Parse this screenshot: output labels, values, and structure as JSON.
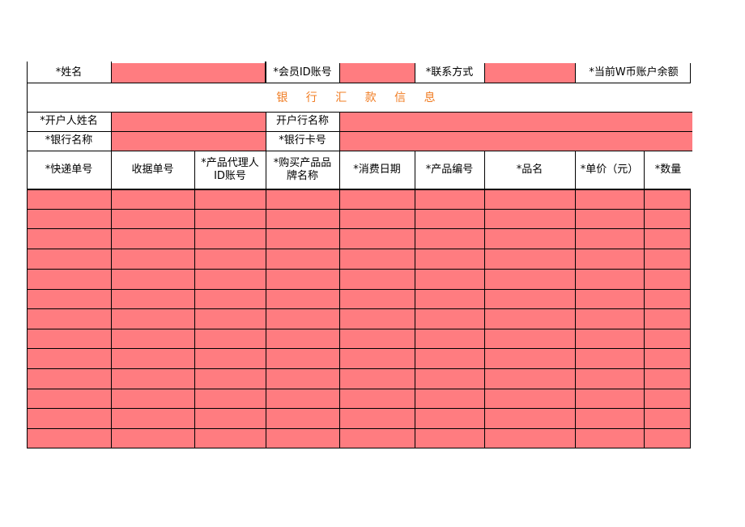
{
  "member_row": {
    "name_label": "*姓名",
    "member_id_label": "*会员ID账号",
    "contact_label": "*联系方式",
    "balance_label": "*当前W币账户余额"
  },
  "section_title": "银 行 汇 款 信 息",
  "bank_rows": {
    "holder_name_label": "*开户人姓名",
    "branch_name_label": "开户行名称",
    "bank_name_label": "*银行名称",
    "card_no_label": "*银行卡号"
  },
  "table": {
    "headers": [
      "*快递单号",
      "收据单号",
      "*产品代理人ID账号",
      "*购买产品品牌名称",
      "*消费日期",
      "*产品编号",
      "*品名",
      "*单价（元）",
      "*数量"
    ],
    "row_count": 13
  },
  "colors": {
    "fill": "#ff7c80",
    "title": "#f07c22",
    "grid": "#000000"
  }
}
